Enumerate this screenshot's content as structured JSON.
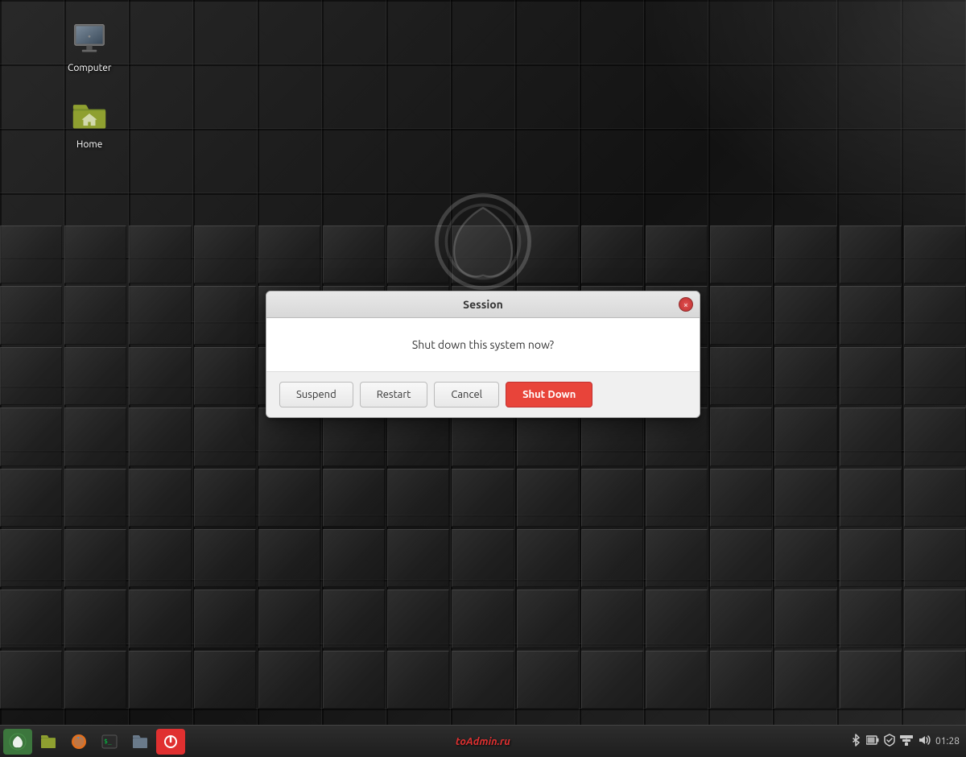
{
  "desktop": {
    "background_color": "#1c1c1c"
  },
  "icons": [
    {
      "id": "computer",
      "label": "Computer",
      "type": "computer"
    },
    {
      "id": "home",
      "label": "Home",
      "type": "folder"
    }
  ],
  "dialog": {
    "title": "Session",
    "message": "Shut down this system now?",
    "buttons": [
      {
        "id": "suspend",
        "label": "Suspend",
        "primary": false
      },
      {
        "id": "restart",
        "label": "Restart",
        "primary": false
      },
      {
        "id": "cancel",
        "label": "Cancel",
        "primary": false
      },
      {
        "id": "shutdown",
        "label": "Shut Down",
        "primary": true
      }
    ],
    "close_label": "×"
  },
  "taskbar": {
    "branding": "toAdmin.ru",
    "clock": "01:28",
    "items": [
      {
        "id": "mint-menu",
        "type": "mint"
      },
      {
        "id": "files",
        "type": "files"
      },
      {
        "id": "firefox",
        "type": "firefox"
      },
      {
        "id": "terminal",
        "type": "terminal"
      },
      {
        "id": "files2",
        "type": "files2"
      },
      {
        "id": "power",
        "type": "power"
      }
    ],
    "system_icons": [
      "bluetooth",
      "battery",
      "shield",
      "network",
      "volume"
    ]
  }
}
